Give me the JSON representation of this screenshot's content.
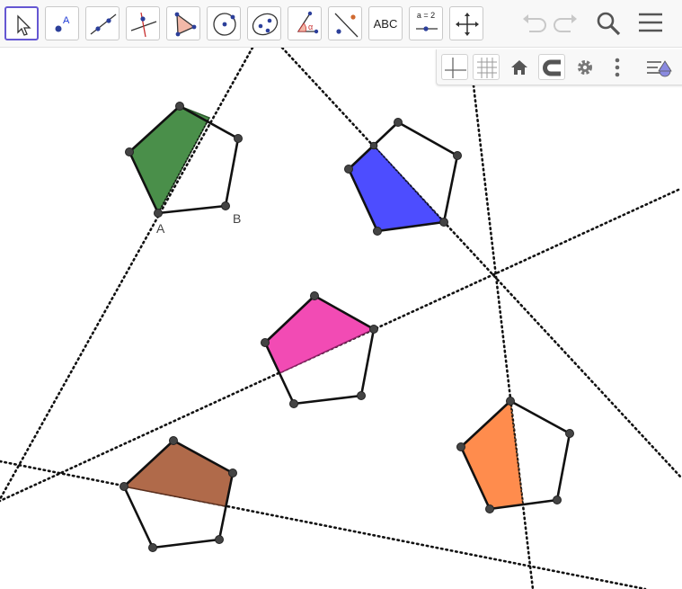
{
  "toolbar": {
    "tools": [
      {
        "id": "move",
        "icon": "move-cursor-icon"
      },
      {
        "id": "point",
        "icon": "point-icon",
        "label": "A"
      },
      {
        "id": "line",
        "icon": "line-icon"
      },
      {
        "id": "perpendicular",
        "icon": "perpendicular-line-icon"
      },
      {
        "id": "polygon",
        "icon": "polygon-icon"
      },
      {
        "id": "circle",
        "icon": "circle-center-icon"
      },
      {
        "id": "conic",
        "icon": "ellipse-icon"
      },
      {
        "id": "angle",
        "icon": "angle-icon",
        "label": "α"
      },
      {
        "id": "reflect",
        "icon": "reflect-about-line-icon"
      },
      {
        "id": "text",
        "icon": "text-icon",
        "label": "ABC"
      },
      {
        "id": "slider",
        "icon": "slider-icon",
        "label": "a = 2"
      },
      {
        "id": "move-graphics",
        "icon": "move-graphics-view-icon"
      }
    ],
    "right": [
      "undo-icon",
      "redo-icon",
      "search-icon",
      "menu-icon"
    ]
  },
  "stylebar": {
    "buttons": [
      "axes-icon",
      "grid-icon",
      "home-icon",
      "magnet-icon",
      "settings-icon",
      "more-icon",
      "view-menu-icon"
    ]
  },
  "canvas": {
    "colors": {
      "green": "#4a8f4a",
      "blue": "#4d4dff",
      "pink": "#f24bb4",
      "brown": "#b06a4a",
      "orange": "#ff8c4d",
      "point": "#444444"
    },
    "labels": {
      "a": "A",
      "b": "B"
    }
  }
}
